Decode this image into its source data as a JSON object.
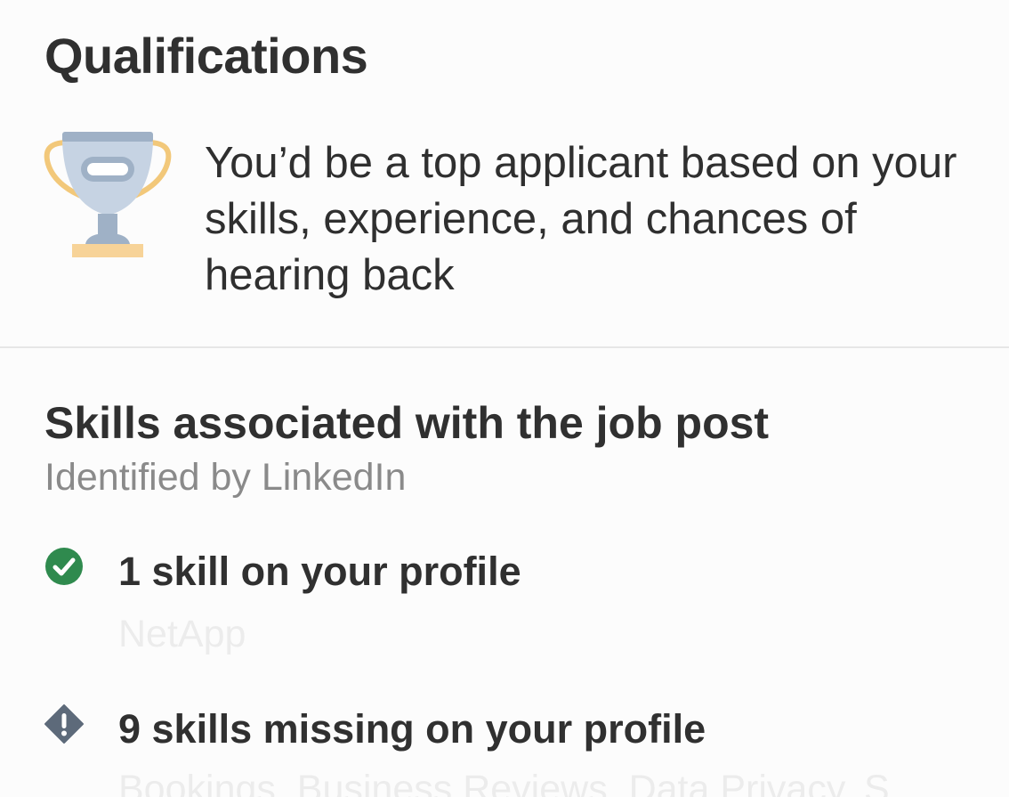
{
  "qualifications": {
    "title": "Qualifications",
    "icon": "trophy-icon",
    "message": "You’d be a top applicant based on your skills, experience, and chances of hearing back"
  },
  "skills": {
    "heading": "Skills associated with the job post",
    "subheading": "Identified by LinkedIn",
    "matched": {
      "icon": "check-circle-icon",
      "label": "1 skill on your profile",
      "detail": "NetApp"
    },
    "missing": {
      "icon": "exclamation-diamond-icon",
      "label": "9 skills missing on your profile",
      "detail": "Bookings, Business Reviews, Data Privacy, S"
    }
  },
  "colors": {
    "check": "#2f8a4e",
    "warning": "#5d6a7a",
    "trophy_cup": "#c6d3e3",
    "trophy_handles": "#f2c87a",
    "trophy_base": "#f7d398"
  }
}
